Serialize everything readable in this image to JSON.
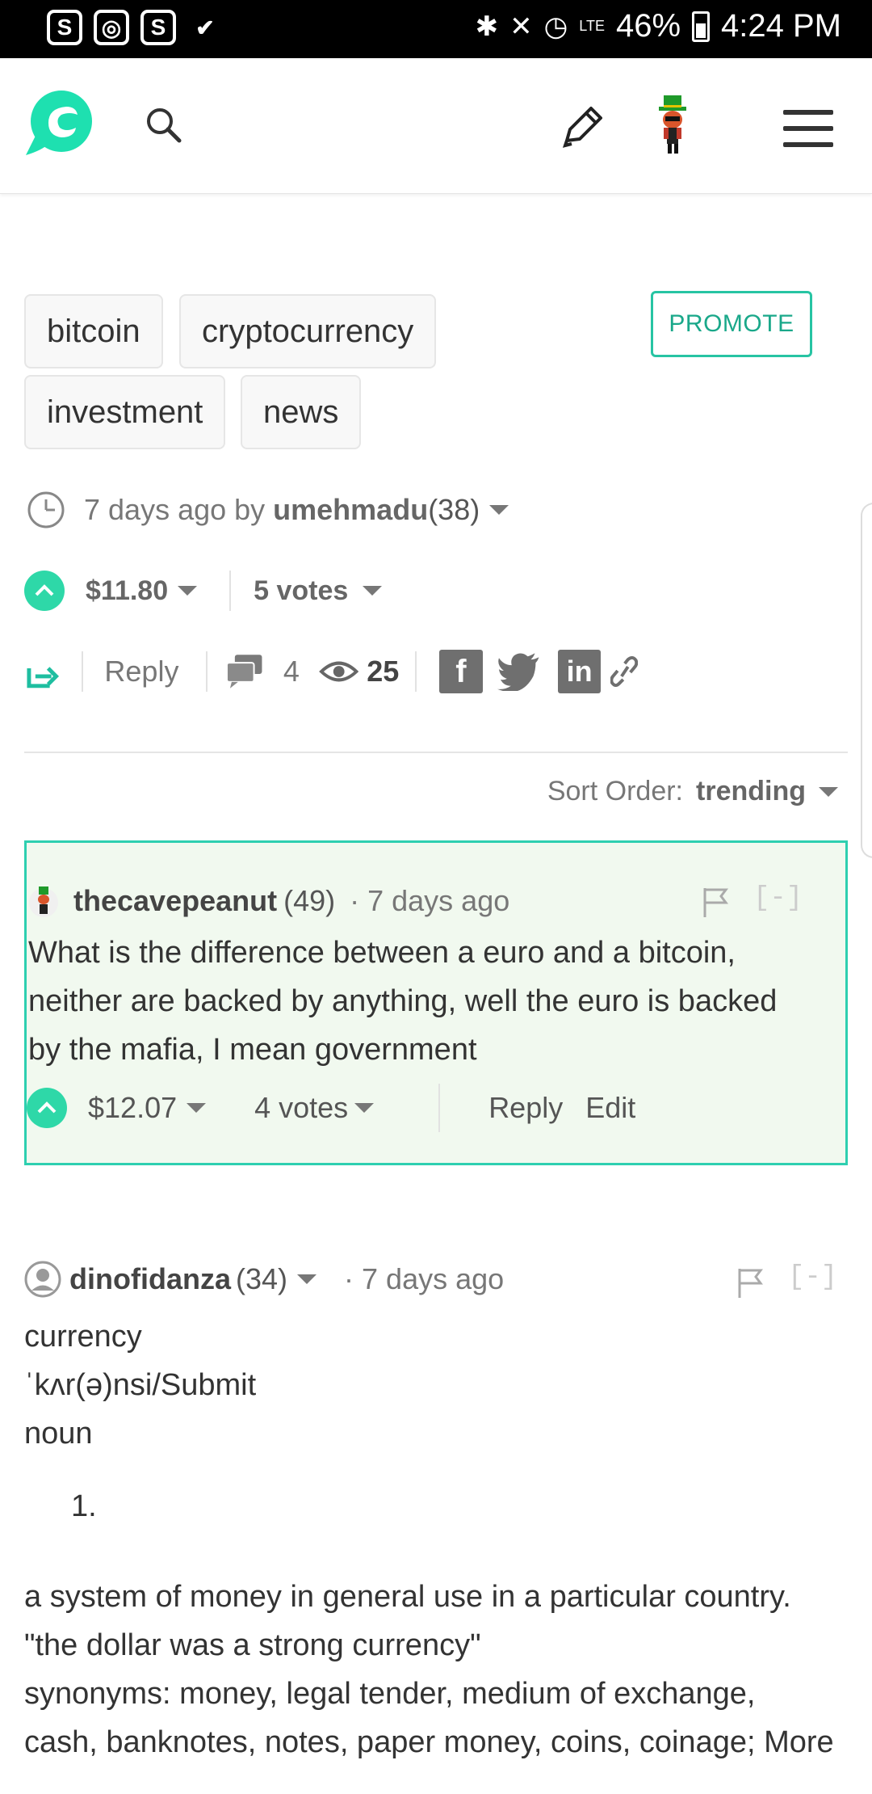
{
  "status_bar": {
    "app_icons": [
      "S",
      "◎",
      "S",
      "✔"
    ],
    "status_icons": [
      "✱",
      "✕",
      "◷",
      "LTE"
    ],
    "battery": "46%",
    "time": "4:24 PM"
  },
  "header": {
    "icons": [
      "steemit-logo-icon",
      "search-icon",
      "pencil-icon",
      "user-avatar",
      "menu-icon"
    ]
  },
  "tags": [
    "bitcoin",
    "cryptocurrency",
    "investment",
    "news"
  ],
  "promote_label": "PROMOTE",
  "post_meta": {
    "ago": "7 days ago by",
    "author": "umehmadu",
    "reputation": "(38)"
  },
  "post_votes": {
    "payout": "$11.80",
    "votes": "5 votes"
  },
  "post_actions": {
    "reply": "Reply",
    "comments_count": "4",
    "views_count": "25"
  },
  "sort": {
    "label": "Sort Order:",
    "value": "trending"
  },
  "comments": [
    {
      "author": "thecavepeanut",
      "reputation": "(49)",
      "ago": "· 7 days ago",
      "collapse": "[-]",
      "lines": [
        "What is the difference between a euro and a bitcoin,",
        "neither are backed by anything, well the euro is backed",
        "by the mafia, I mean government"
      ],
      "payout": "$12.07",
      "votes": "4 votes",
      "reply": "Reply",
      "edit": "Edit"
    },
    {
      "author": "dinofidanza",
      "reputation": "(34)",
      "ago": "· 7 days ago",
      "collapse": "[-]",
      "lines": [
        "currency",
        "ˈkʌr(ə)nsi/Submit",
        "noun"
      ],
      "list_number": "1.",
      "definition_lines": [
        "a system of money in general use in a particular country.",
        "\"the dollar was a strong currency\"",
        "synonyms: money, legal tender, medium of exchange,",
        "cash, banknotes, notes, paper money, coins, coinage; More"
      ]
    }
  ]
}
